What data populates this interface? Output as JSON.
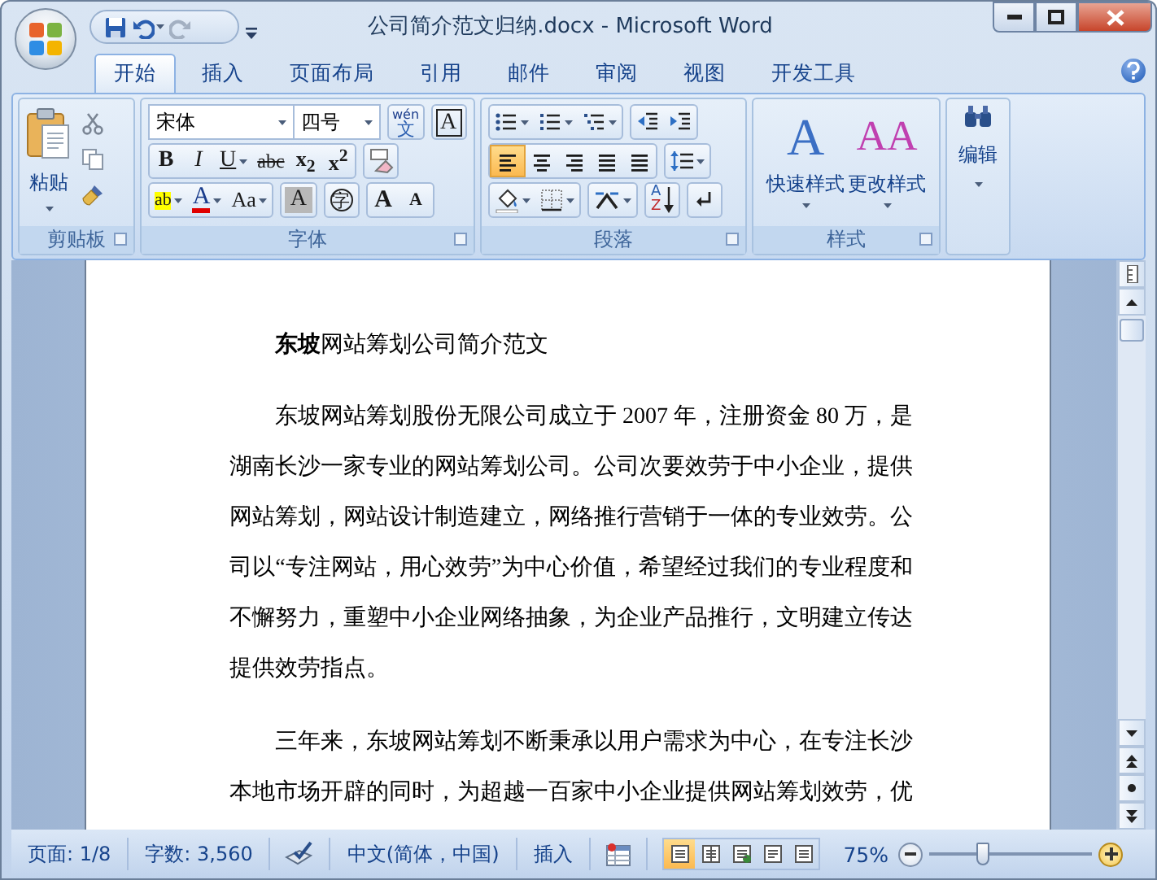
{
  "window": {
    "title": "公司简介范文归纳.docx - Microsoft Word"
  },
  "quick_access": [
    {
      "kind": "save",
      "disabled": false
    },
    {
      "kind": "undo",
      "disabled": false
    },
    {
      "kind": "redo",
      "disabled": true
    }
  ],
  "tabs": [
    {
      "label": "开始",
      "selected": true
    },
    {
      "label": "插入",
      "selected": false
    },
    {
      "label": "页面布局",
      "selected": false
    },
    {
      "label": "引用",
      "selected": false
    },
    {
      "label": "邮件",
      "selected": false
    },
    {
      "label": "审阅",
      "selected": false
    },
    {
      "label": "视图",
      "selected": false
    },
    {
      "label": "开发工具",
      "selected": false
    }
  ],
  "clipboard": {
    "label": "剪贴板",
    "paste": "粘贴"
  },
  "font": {
    "label": "字体",
    "font_name": "宋体",
    "font_size": "四号",
    "row1": [
      {
        "kind": "phonetic",
        "top": "wén",
        "label": "文"
      },
      {
        "kind": "border",
        "label": "A"
      }
    ],
    "row2": [
      {
        "kind": "bold",
        "label": "B"
      },
      {
        "kind": "italic",
        "label": "I"
      },
      {
        "kind": "underline",
        "label": "U",
        "dropdown": true
      },
      {
        "kind": "strike",
        "label": "abc"
      },
      {
        "kind": "sub",
        "label": "x$_{2}$"
      },
      {
        "kind": "sup",
        "label": "x$^{2}$"
      }
    ],
    "row3": [
      {
        "kind": "highlight",
        "label": "ab",
        "dropdown": true
      },
      {
        "kind": "font_color",
        "label": "A",
        "dropdown": true
      },
      {
        "kind": "case",
        "label": "Aa",
        "dropdown": true
      },
      {
        "kind": "shading",
        "label": "A"
      },
      {
        "kind": "enclose",
        "label": "字"
      },
      {
        "kind": "grow",
        "label": "A"
      },
      {
        "kind": "shrink",
        "label": "A"
      }
    ]
  },
  "paragraph": {
    "label": "段落",
    "align": [
      {
        "kind": "left",
        "selected": true
      },
      {
        "kind": "center",
        "selected": false
      },
      {
        "kind": "right",
        "selected": false
      },
      {
        "kind": "justify",
        "selected": false
      },
      {
        "kind": "distributed",
        "selected": false
      }
    ],
    "sort": {
      "top": "A",
      "bottom": "Z"
    }
  },
  "styles": {
    "label": "样式",
    "items": [
      {
        "glyph": "A",
        "label": "快速样式"
      },
      {
        "glyph": "AA",
        "label": "更改样式"
      }
    ]
  },
  "editing": {
    "label": "编辑"
  },
  "document": [
    {
      "kind": "heading",
      "text": "**东坡**网站筹划公司简介范文"
    },
    {
      "kind": "body",
      "text": "东坡网站筹划股份无限公司成立于 2007 年，注册资金 80 万，是湖南长沙一家专业的网站筹划公司。公司次要效劳于中小企业，提供网站筹划，网站设计制造建立，网络推行营销于一体的专业效劳。公司以“专注网站，用心效劳”为中心价值，希望经过我们的专业程度和不懈努力，重塑中小企业网络抽象，为企业产品推行，文明建立传达提供效劳指点。"
    },
    {
      "kind": "body",
      "text": "三年来，东坡网站筹划不断秉承以用户需求为中心，在专注长沙本地市场开辟的同时，为超越一百家中小企业提供网站筹划效劳，优"
    }
  ],
  "status_bar": [
    {
      "kind": "text",
      "label": "页面: 1/8"
    },
    {
      "kind": "text",
      "label": "字数: 3,560"
    },
    {
      "kind": "proofing"
    },
    {
      "kind": "text",
      "label": "中文(简体，中国)"
    },
    {
      "kind": "text",
      "label": "插入"
    },
    {
      "kind": "macro"
    }
  ],
  "views": [
    {
      "kind": "print",
      "selected": true
    },
    {
      "kind": "reading",
      "selected": false
    },
    {
      "kind": "web",
      "selected": false
    },
    {
      "kind": "outline",
      "selected": false
    },
    {
      "kind": "draft",
      "selected": false
    }
  ],
  "zoom": {
    "label": "75%",
    "level": 0.33
  }
}
